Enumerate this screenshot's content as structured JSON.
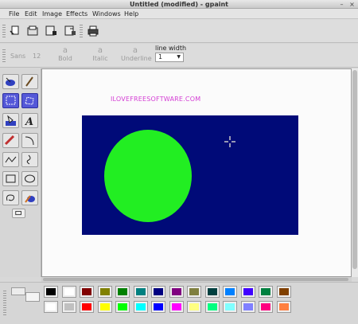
{
  "window": {
    "title": "Untitled (modified) - gpaint"
  },
  "menu": [
    "File",
    "Edit",
    "Image",
    "Effects",
    "Windows",
    "Help"
  ],
  "toolbar": {
    "buttons": [
      "new-icon",
      "open-icon",
      "save-icon",
      "save-as-icon",
      "print-icon"
    ]
  },
  "text_toolbar": {
    "font": "Sans",
    "size": "12",
    "bold": "Bold",
    "italic": "Italic",
    "underline": "Underline",
    "line_width_label": "line width",
    "line_width_value": "1"
  },
  "canvas": {
    "watermark": "ILOVEFREESOFTWARE.COM",
    "background": "#000a78",
    "ellipse_color": "#22ee22"
  },
  "palette": {
    "row1": [
      "#000000",
      "#ffffff",
      "#800000",
      "#808000",
      "#008000",
      "#008080",
      "#000080",
      "#800080",
      "#808040",
      "#004040",
      "#0080ff",
      "#4000ff",
      "#008040",
      "#804000"
    ],
    "row2": [
      "#ffffff",
      "#c0c0c0",
      "#ff0000",
      "#ffff00",
      "#00ff00",
      "#00ffff",
      "#0000ff",
      "#ff00ff",
      "#ffff80",
      "#00ff80",
      "#80ffff",
      "#8080ff",
      "#ff0080",
      "#ff8040"
    ]
  }
}
